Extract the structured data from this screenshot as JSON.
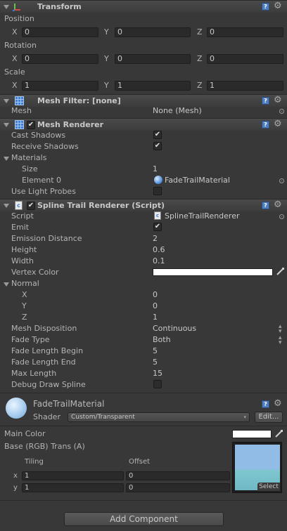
{
  "transform": {
    "title": "Transform",
    "position_label": "Position",
    "rotation_label": "Rotation",
    "scale_label": "Scale",
    "axis_x": "X",
    "axis_y": "Y",
    "axis_z": "Z",
    "position": {
      "x": "0",
      "y": "0",
      "z": "0"
    },
    "rotation": {
      "x": "0",
      "y": "0",
      "z": "0"
    },
    "scale": {
      "x": "1",
      "y": "1",
      "z": "1"
    }
  },
  "mesh_filter": {
    "title": "Mesh Filter: [none]",
    "mesh_label": "Mesh",
    "mesh_value": "None (Mesh)"
  },
  "mesh_renderer": {
    "title": "Mesh Renderer",
    "enabled": true,
    "cast_shadows_label": "Cast Shadows",
    "cast_shadows": true,
    "receive_shadows_label": "Receive Shadows",
    "receive_shadows": true,
    "materials_label": "Materials",
    "size_label": "Size",
    "size_value": "1",
    "element0_label": "Element 0",
    "element0_value": "FadeTrailMaterial",
    "light_probes_label": "Use Light Probes",
    "light_probes": false
  },
  "spline_trail": {
    "title": "Spline Trail Renderer (Script)",
    "enabled": true,
    "script_label": "Script",
    "script_value": "SplineTrailRenderer",
    "emit_label": "Emit",
    "emit": true,
    "emission_distance_label": "Emission Distance",
    "emission_distance": "2",
    "height_label": "Height",
    "height": "0.6",
    "width_label": "Width",
    "width": "0.1",
    "vertex_color_label": "Vertex Color",
    "vertex_color": "#ffffff",
    "normal_label": "Normal",
    "normal": {
      "x_label": "X",
      "x": "0",
      "y_label": "Y",
      "y": "0",
      "z_label": "Z",
      "z": "1"
    },
    "mesh_disposition_label": "Mesh Disposition",
    "mesh_disposition": "Continuous",
    "fade_type_label": "Fade Type",
    "fade_type": "Both",
    "fade_length_begin_label": "Fade Length Begin",
    "fade_length_begin": "5",
    "fade_length_end_label": "Fade Length End",
    "fade_length_end": "5",
    "max_length_label": "Max Length",
    "max_length": "15",
    "debug_draw_label": "Debug Draw Spline",
    "debug_draw": false
  },
  "material": {
    "name": "FadeTrailMaterial",
    "shader_label": "Shader",
    "shader_value": "Custom/Transparent",
    "edit_label": "Edit...",
    "main_color_label": "Main Color",
    "main_color": "#ffffff",
    "base_label": "Base (RGB) Trans (A)",
    "tiling_label": "Tiling",
    "offset_label": "Offset",
    "x_label": "x",
    "y_label": "y",
    "tiling_x": "1",
    "tiling_y": "1",
    "offset_x": "0",
    "offset_y": "0",
    "select_label": "Select"
  },
  "add_component_label": "Add Component",
  "colors": {
    "panel_bg": "#383838",
    "header_bg": "#474747",
    "field_bg": "#2a2a2a",
    "help_blue": "#4f7ec0",
    "texture_sky": "#8fb7e3",
    "texture_teal": "#7fc6cf"
  },
  "icons": {
    "transform": "transform-gizmo-icon",
    "mesh_filter": "grid-mesh-icon",
    "mesh_renderer": "grid-mesh-icon",
    "script": "csharp-script-icon",
    "help": "help-book-icon",
    "settings": "gear-icon",
    "picker": "object-picker-icon",
    "eyedropper": "eyedropper-icon"
  }
}
